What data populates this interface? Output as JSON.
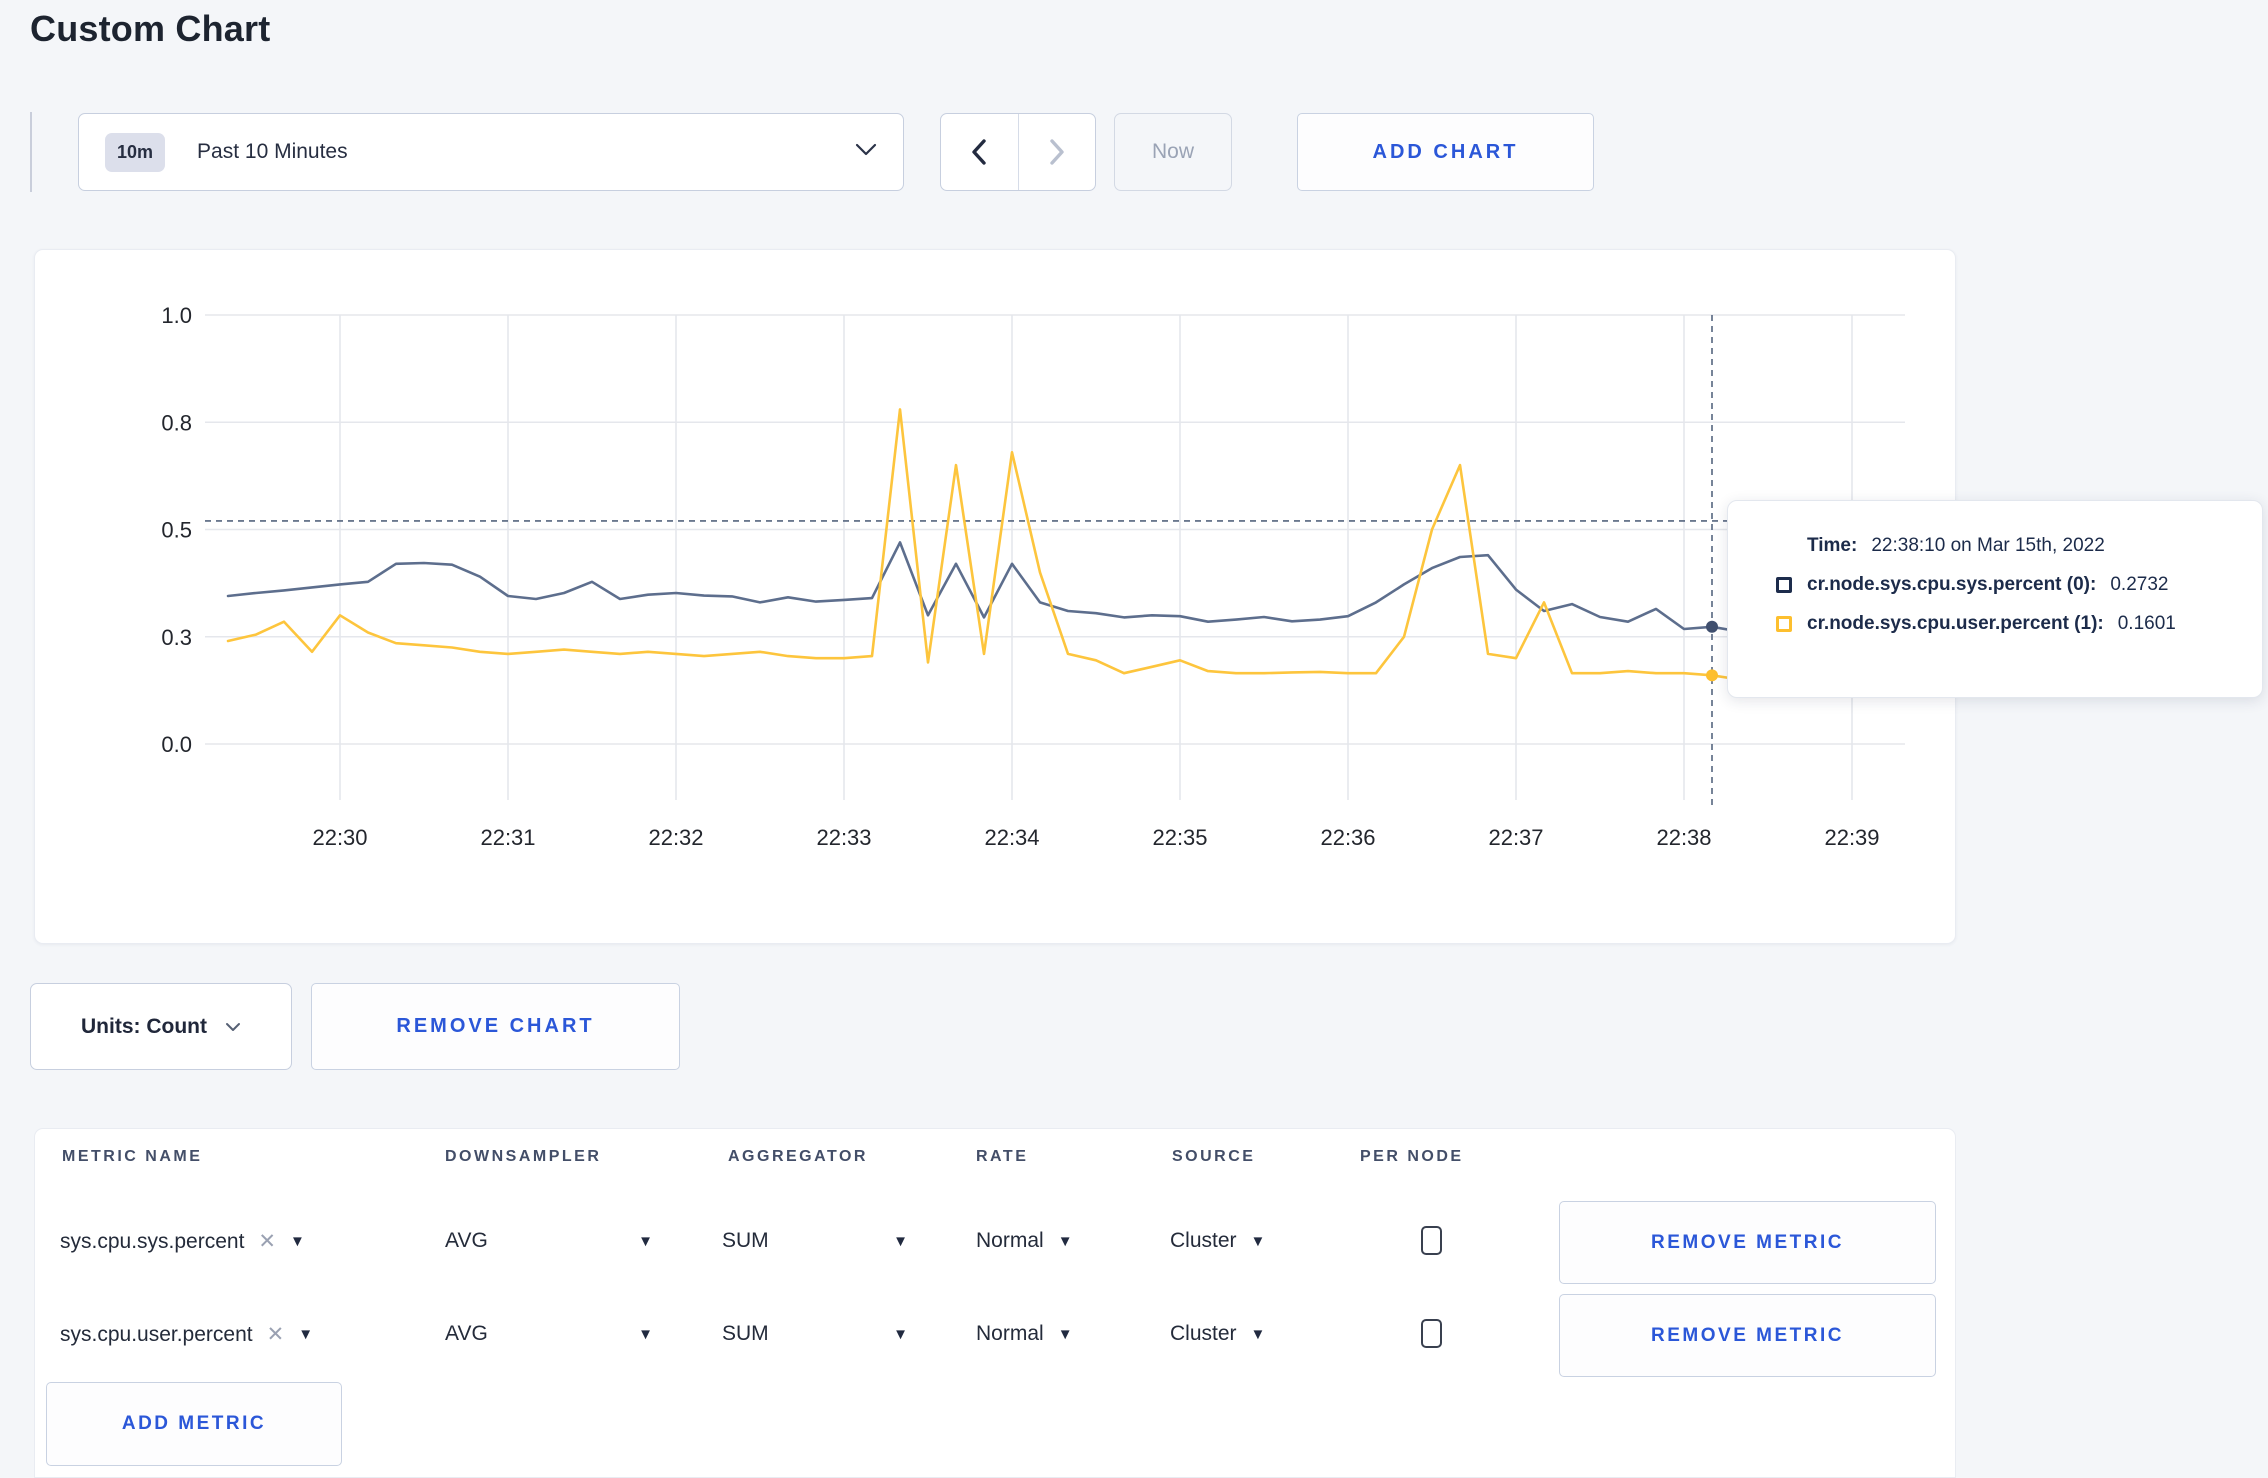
{
  "page": {
    "title": "Custom Chart",
    "background": "#f4f6f9",
    "accent_blue": "#2b57d8"
  },
  "toolbar": {
    "time_range_badge": "10m",
    "time_range_label": "Past 10 Minutes",
    "now_label": "Now",
    "add_chart_label": "ADD CHART"
  },
  "chart_data": {
    "type": "line",
    "title": "",
    "xlabel": "",
    "ylabel": "",
    "ylim": [
      0,
      1.0
    ],
    "ytick_values": [
      0,
      0.25,
      0.5,
      0.75,
      1.0
    ],
    "ytick_labels": [
      "0.0",
      "0.3",
      "0.5",
      "0.8",
      "1.0"
    ],
    "xtick_labels": [
      "22:30",
      "22:31",
      "22:32",
      "22:33",
      "22:34",
      "22:35",
      "22:36",
      "22:37",
      "22:38",
      "22:39"
    ],
    "grid": true,
    "legend_position": "none",
    "x": [
      "22:29:20",
      "22:29:30",
      "22:29:40",
      "22:29:50",
      "22:30:00",
      "22:30:10",
      "22:30:20",
      "22:30:30",
      "22:30:40",
      "22:30:50",
      "22:31:00",
      "22:31:10",
      "22:31:20",
      "22:31:30",
      "22:31:40",
      "22:31:50",
      "22:32:00",
      "22:32:10",
      "22:32:20",
      "22:32:30",
      "22:32:40",
      "22:32:50",
      "22:33:00",
      "22:33:10",
      "22:33:20",
      "22:33:30",
      "22:33:40",
      "22:33:50",
      "22:34:00",
      "22:34:10",
      "22:34:20",
      "22:34:30",
      "22:34:40",
      "22:34:50",
      "22:35:00",
      "22:35:10",
      "22:35:20",
      "22:35:30",
      "22:35:40",
      "22:35:50",
      "22:36:00",
      "22:36:10",
      "22:36:20",
      "22:36:30",
      "22:36:40",
      "22:36:50",
      "22:37:00",
      "22:37:10",
      "22:37:20",
      "22:37:30",
      "22:37:40",
      "22:37:50",
      "22:38:00",
      "22:38:10",
      "22:38:20",
      "22:38:30",
      "22:38:40",
      "22:38:50",
      "22:39:00",
      "22:39:10"
    ],
    "series": [
      {
        "name": "cr.node.sys.cpu.sys.percent (0)",
        "color": "#5d6e8d",
        "values": [
          0.345,
          0.352,
          0.358,
          0.365,
          0.372,
          0.378,
          0.42,
          0.422,
          0.418,
          0.39,
          0.345,
          0.338,
          0.352,
          0.378,
          0.338,
          0.348,
          0.352,
          0.346,
          0.344,
          0.33,
          0.342,
          0.332,
          0.336,
          0.34,
          0.47,
          0.3,
          0.42,
          0.295,
          0.42,
          0.33,
          0.31,
          0.305,
          0.295,
          0.3,
          0.298,
          0.285,
          0.29,
          0.296,
          0.286,
          0.29,
          0.298,
          0.33,
          0.372,
          0.41,
          0.436,
          0.44,
          0.36,
          0.31,
          0.326,
          0.296,
          0.285,
          0.315,
          0.268,
          0.2732,
          0.262,
          0.285,
          0.312,
          0.296,
          0.302,
          0.306
        ]
      },
      {
        "name": "cr.node.sys.cpu.user.percent (1)",
        "color": "#fdc53d",
        "values": [
          0.24,
          0.255,
          0.285,
          0.215,
          0.3,
          0.26,
          0.235,
          0.23,
          0.225,
          0.215,
          0.21,
          0.215,
          0.22,
          0.215,
          0.21,
          0.215,
          0.21,
          0.205,
          0.21,
          0.215,
          0.205,
          0.2,
          0.2,
          0.205,
          0.78,
          0.19,
          0.65,
          0.21,
          0.68,
          0.4,
          0.21,
          0.195,
          0.165,
          0.18,
          0.195,
          0.17,
          0.165,
          0.165,
          0.167,
          0.168,
          0.165,
          0.165,
          0.25,
          0.5,
          0.65,
          0.21,
          0.2,
          0.33,
          0.165,
          0.165,
          0.17,
          0.165,
          0.165,
          0.1601,
          0.15,
          0.145,
          0.15,
          0.155,
          0.28,
          0.24
        ]
      }
    ],
    "hover": {
      "time": "22:38:10",
      "hline_value": 0.52,
      "dot_values": [
        0.2732,
        0.1601
      ],
      "dot_colors": [
        "#3f4f6e",
        "#fdbf2e"
      ],
      "dash_color": "#55657f"
    },
    "gridline_color": "#e5e7ec",
    "axis_label_color": "#23262d"
  },
  "tooltip": {
    "time_label": "Time:",
    "time_value": "22:38:10 on Mar 15th, 2022",
    "rows": [
      {
        "swatch_color": "#1d2c4c",
        "label": "cr.node.sys.cpu.sys.percent (0):",
        "value": "0.2732"
      },
      {
        "swatch_color": "#fdbf2e",
        "label": "cr.node.sys.cpu.user.percent (1):",
        "value": "0.1601"
      }
    ]
  },
  "chart_footer": {
    "units_label": "Units: Count",
    "remove_chart_label": "REMOVE CHART"
  },
  "metrics_table": {
    "headers": [
      "METRIC NAME",
      "DOWNSAMPLER",
      "AGGREGATOR",
      "RATE",
      "SOURCE",
      "PER NODE"
    ],
    "rows": [
      {
        "metric": "sys.cpu.sys.percent",
        "remove_x": "✕",
        "downsampler": "AVG",
        "aggregator": "SUM",
        "rate": "Normal",
        "source": "Cluster",
        "per_node_checked": false,
        "remove_label": "REMOVE METRIC"
      },
      {
        "metric": "sys.cpu.user.percent",
        "remove_x": "✕",
        "downsampler": "AVG",
        "aggregator": "SUM",
        "rate": "Normal",
        "source": "Cluster",
        "per_node_checked": false,
        "remove_label": "REMOVE METRIC"
      }
    ],
    "add_metric_label": "ADD METRIC"
  }
}
